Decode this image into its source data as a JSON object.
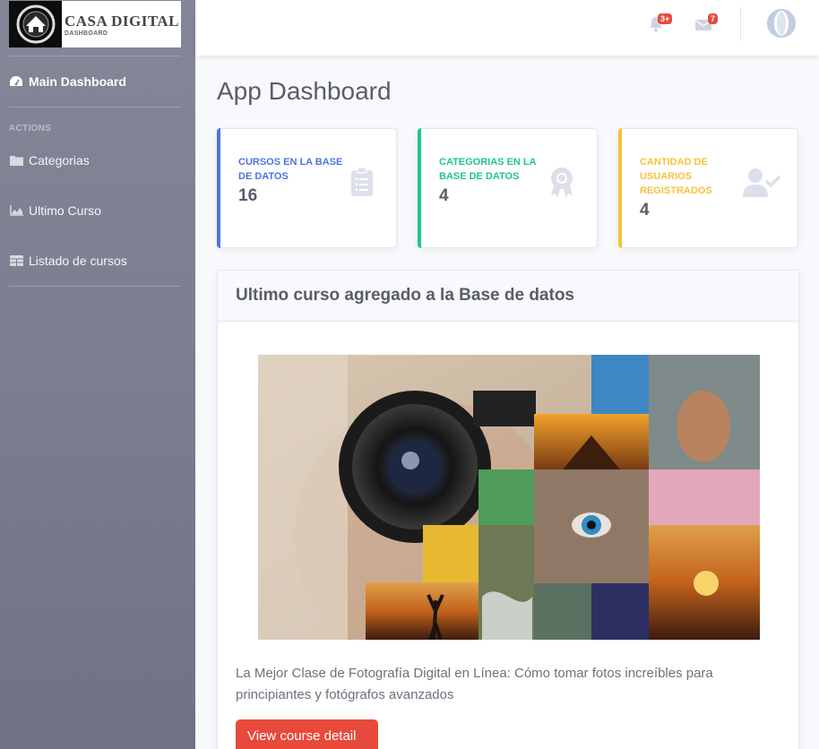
{
  "brand": {
    "title": "CASA DIGITAL",
    "subtitle": "DASHBOARD"
  },
  "sidebar": {
    "main_item": {
      "label": "Main Dashboard",
      "icon": "tachometer-icon"
    },
    "heading": "ACTIONS",
    "items": [
      {
        "label": "Categorias",
        "icon": "folder-icon"
      },
      {
        "label": "Ultimo Curso",
        "icon": "chart-area-icon"
      },
      {
        "label": "Listado de cursos",
        "icon": "table-icon"
      }
    ]
  },
  "topbar": {
    "alerts_badge": "3+",
    "messages_badge": "7"
  },
  "page": {
    "title": "App Dashboard"
  },
  "stats": [
    {
      "label": "CURSOS EN LA BASE DE DATOS",
      "value": "16",
      "color": "#4e73df",
      "icon": "clipboard-list-icon"
    },
    {
      "label": "CATEGORIAS EN LA BASE DE DATOS",
      "value": "4",
      "color": "#1cc88a",
      "icon": "award-icon"
    },
    {
      "label": "CANTIDAD DE USUARIOS REGISTRADOS",
      "value": "4",
      "color": "#f6c23e",
      "icon": "user-check-icon"
    }
  ],
  "latest_course": {
    "heading": "Ultimo curso agregado a la Base de datos",
    "description": "La Mejor Clase de Fotografía Digital en Línea: Cómo tomar fotos increíbles para principiantes y fotógrafos avanzados",
    "button_label": "View course detail"
  }
}
